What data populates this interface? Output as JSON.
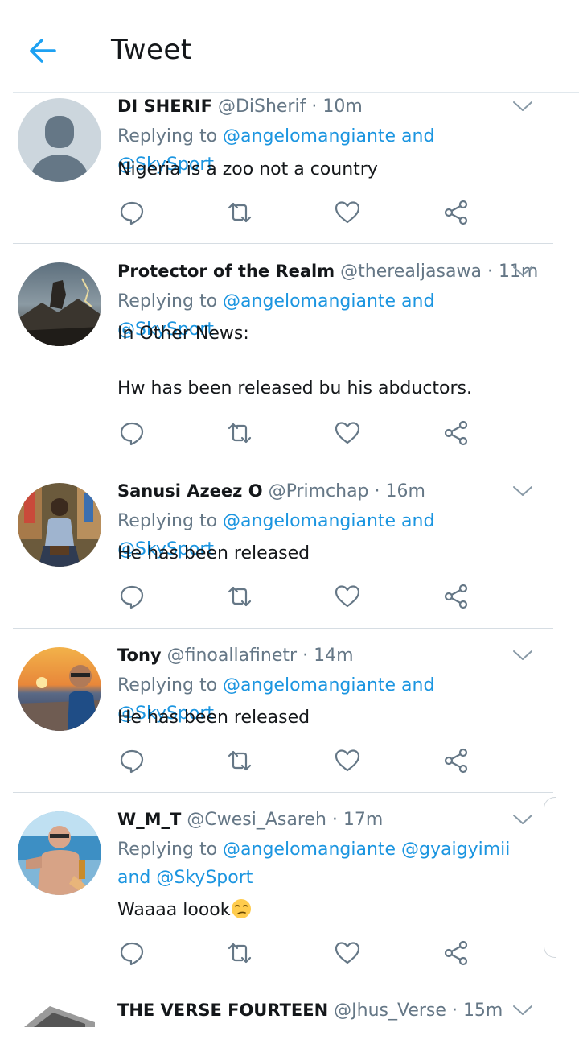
{
  "header": {
    "title": "Tweet",
    "back_icon": "arrow-left-icon",
    "accent": "#1da1f2"
  },
  "tweets": [
    {
      "name": "DI SHERIF",
      "handle": "@DiSherif",
      "sep": "·",
      "time": "10m",
      "replying_prefix": "Replying to",
      "mentions": [
        "@angelomangiante",
        "and",
        "@SkySport"
      ],
      "text": "Nigeria is a zoo not a country"
    },
    {
      "name": "Protector of the Realm",
      "handle": "@therealjasawa",
      "sep": "·",
      "time": "11m",
      "replying_prefix": "Replying to",
      "mentions": [
        "@angelomangiante",
        "and",
        "@SkySport"
      ],
      "text": "In Other News:\n\nHw has been released bu his abductors."
    },
    {
      "name": "Sanusi Azeez O",
      "handle": "@Primchap",
      "sep": "·",
      "time": "16m",
      "replying_prefix": "Replying to",
      "mentions": [
        "@angelomangiante",
        "and",
        "@SkySport"
      ],
      "text": "He has been released"
    },
    {
      "name": "Tony",
      "handle": "@finoallafinetr",
      "sep": "·",
      "time": "14m",
      "replying_prefix": "Replying to",
      "mentions": [
        "@angelomangiante",
        "and",
        "@SkySport"
      ],
      "text": "He has been released"
    },
    {
      "name": "W_M_T",
      "handle": "@Cwesi_Asareh",
      "sep": "·",
      "time": "17m",
      "replying_prefix": "Replying to",
      "mentions": [
        "@angelomangiante",
        "@gyaigyimii",
        "and",
        "@SkySport"
      ],
      "text": "Waaaa loook",
      "emoji": "unamused-face-emoji"
    },
    {
      "name": "THE VERSE FOURTEEN",
      "handle": "@Jhus_Verse",
      "sep": "·",
      "time": "15m"
    }
  ],
  "action_icons": [
    "reply-icon",
    "retweet-icon",
    "like-icon",
    "share-icon"
  ],
  "colors": {
    "text": "#14171a",
    "secondary": "#657786",
    "link": "#1b95e0",
    "icon": "#657786",
    "divider": "#e1e8ed"
  }
}
